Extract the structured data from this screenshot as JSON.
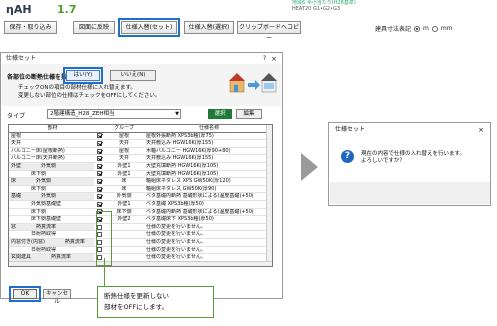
{
  "app": {
    "eta_label": "ηAH",
    "eta_value": "1.7",
    "meta_line1": "地域6 半小当たり(H28基準)",
    "meta_line2": "HEAT20 G1•G2•G3"
  },
  "toolbar": {
    "save_load": "保存・取り込み",
    "print_plan": "図面に反映",
    "spec_set": "仕様入替(セット)",
    "spec_select": "仕様入替(選択)",
    "clipboard": "クリップボードへコピー",
    "unit_label": "建具寸法表記",
    "unit_m": "m",
    "unit_cm": "mm"
  },
  "dialog1": {
    "title": "仕様セット",
    "help": "?",
    "close": "×",
    "head_title": "各部位の断熱仕様を指定します。",
    "head_line1": "チェックONの項目の部材仕様に入れ替えます。",
    "head_line2": "変更しない部位の仕様はチェックをOFFにしてください。",
    "type_label": "タイプ",
    "type_value": "2階建構造_H28_ZEH相当",
    "select_button": "選択",
    "edit_button": "編集",
    "ok_button": "OK",
    "cancel_button": "キャンセル",
    "columns": [
      "部材",
      "",
      "グループ",
      "仕様名称"
    ],
    "rows": [
      {
        "part": "屋根",
        "sub": "",
        "checked": true,
        "group": "屋根",
        "spec": "屋根外張断熱 XPS3b種(厚75)",
        "gray": false
      },
      {
        "part": "天井",
        "sub": "",
        "checked": true,
        "group": "天井",
        "spec": "天井敷込み HGW16K(厚155)",
        "gray": false
      },
      {
        "part": "バルコニー床(屋根断熱)",
        "sub": "",
        "checked": true,
        "group": "屋根",
        "spec": "木軸バルコニー HGW16K(厚90+80)",
        "gray": false
      },
      {
        "part": "バルコニー床(天井断熱)",
        "sub": "",
        "checked": true,
        "group": "天井",
        "spec": "天井敷込み HGW16K(厚155)",
        "gray": false
      },
      {
        "part": "外壁",
        "sub": "外気側",
        "checked": true,
        "group": "外壁1",
        "spec": "大壁充填断熱 HGW16K(厚105)",
        "gray": true
      },
      {
        "part": "",
        "sub": "床下側",
        "checked": true,
        "group": "外壁1",
        "spec": "大壁充填断熱 HGW16K(厚105)",
        "gray": false
      },
      {
        "part": "床",
        "sub": "外気側",
        "checked": true,
        "group": "床",
        "spec": "軸組床ネダレス XPS GW50K(厚120)",
        "gray": true
      },
      {
        "part": "",
        "sub": "床下側",
        "checked": true,
        "group": "床",
        "spec": "軸組床ネダレス GW50K(厚90)",
        "gray": false
      },
      {
        "part": "基礎",
        "sub": "外気側",
        "checked": true,
        "group": "外気側",
        "spec": "ベタ基礎内断熱 基礎形状による(温度基礎)+50(",
        "gray": true
      },
      {
        "part": "",
        "sub": "外気側基礎壁",
        "checked": true,
        "group": "外壁1",
        "spec": "ベタ基礎 XPS3b種(厚50)",
        "gray": false
      },
      {
        "part": "",
        "sub": "床下側",
        "checked": true,
        "group": "床下側",
        "spec": "ベタ基礎内断熱 基礎形状による(温度基礎)+50(",
        "gray": false
      },
      {
        "part": "",
        "sub": "床下側基礎壁",
        "checked": true,
        "group": "外壁2",
        "spec": "ベタ基礎床下 XPS3b種(厚50)",
        "gray": false
      },
      {
        "part": "窓",
        "sub": "熱貫流率",
        "checked": false,
        "group": "",
        "spec": "仕様の変更を行いません。",
        "gray": true
      },
      {
        "part": "",
        "sub": "日射熱取得",
        "checked": false,
        "group": "",
        "spec": "仕様の変更を行いません。",
        "gray": false
      },
      {
        "part": "内窓付き(内窓)",
        "sub": "熱貫流率",
        "checked": false,
        "group": "",
        "spec": "仕様の変更を行いません。",
        "gray": true
      },
      {
        "part": "",
        "sub": "日射熱取得",
        "checked": false,
        "group": "",
        "spec": "仕様の変更を行いません。",
        "gray": false
      },
      {
        "part": "玄関建具",
        "sub": "熱貫流率",
        "checked": false,
        "group": "",
        "spec": "仕様の変更を行いません。",
        "gray": true
      }
    ]
  },
  "callout": {
    "line1": "断熱仕様を更新しない",
    "line2": "部材をOFFにします。"
  },
  "dialog2": {
    "title": "仕様セット",
    "close": "×",
    "message_line1": "現在の内容で仕様の入れ替えを行います。",
    "message_line2": "よろしいですか？",
    "yes_button": "はい(Y)",
    "no_button": "いいえ(N)"
  }
}
